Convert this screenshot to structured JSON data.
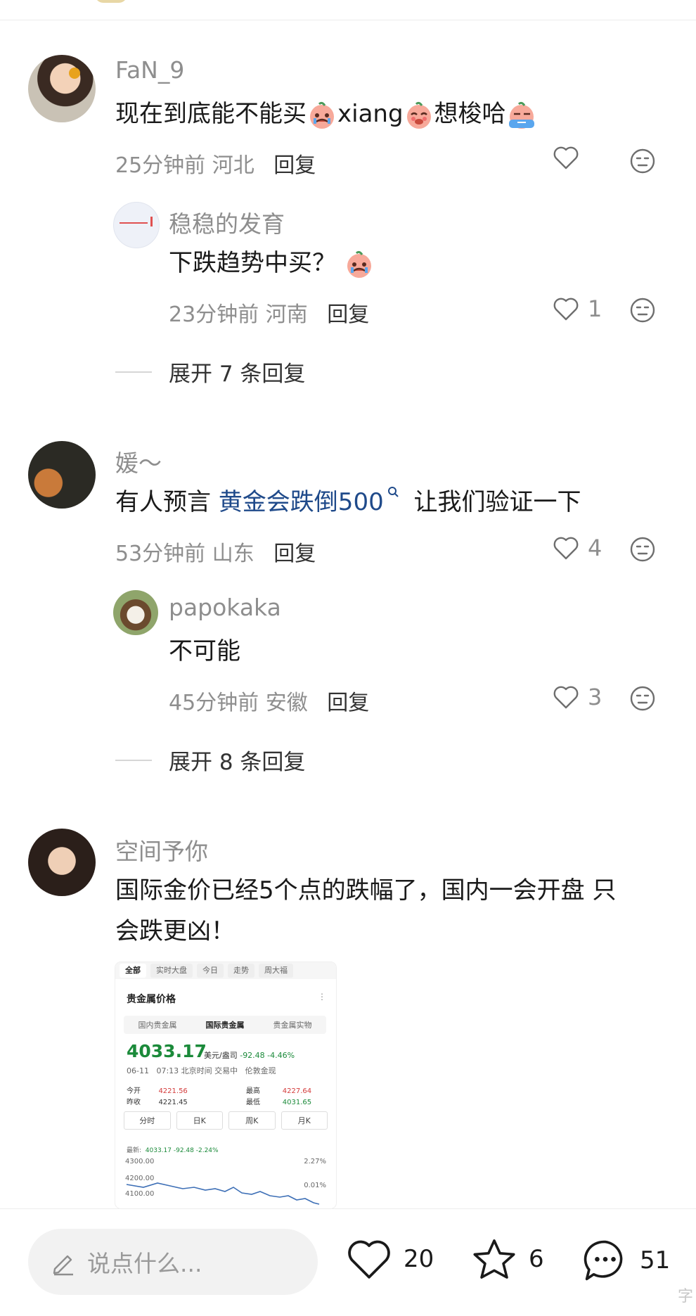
{
  "comments": [
    {
      "username": "FaN_9",
      "text_parts": [
        "现在到底能不能买",
        "xiang",
        "想梭哈"
      ],
      "time": "25分钟前",
      "location": "河北",
      "reply_label": "回复",
      "likes": "",
      "replies": [
        {
          "username": "稳稳的发育",
          "text": "下跌趋势中买？",
          "time": "23分钟前",
          "location": "河南",
          "reply_label": "回复",
          "likes": "1"
        }
      ],
      "expand_label": "展开 7 条回复"
    },
    {
      "username": "媛～",
      "text_prefix": "有人预言 ",
      "link_text": "黄金会跌倒500",
      "text_suffix": "让我们验证一下",
      "time": "53分钟前",
      "location": "山东",
      "reply_label": "回复",
      "likes": "4",
      "replies": [
        {
          "username": "papokaka",
          "text": "不可能",
          "time": "45分钟前",
          "location": "安徽",
          "reply_label": "回复",
          "likes": "3"
        }
      ],
      "expand_label": "展开 8 条回复"
    },
    {
      "username": "空间予你",
      "text_line1": "国际金价已经5个点的跌幅了，国内一会开盘 只",
      "text_line2": "会跌更凶！",
      "image": {
        "tabs": [
          "全部",
          "实时大盘",
          "今日",
          "走势",
          "周大福"
        ],
        "title": "贵金属价格",
        "more": "⋮",
        "subtabs": [
          "国内贵金属",
          "国际贵金属",
          "贵金属实物"
        ],
        "price": "4033.17",
        "unit": "美元/盎司",
        "change": "-92.48 -4.46%",
        "date": "06-11",
        "time_info": "07:13 北京时间 交易中",
        "market": "伦敦金现",
        "open_label": "今开",
        "open_value": "4221.56",
        "prev_label": "昨收",
        "prev_value": "4221.45",
        "high_label": "最高",
        "high_value": "4227.64",
        "low_label": "最低",
        "low_value": "4031.65",
        "periods": [
          "分时",
          "日K",
          "周K",
          "月K"
        ],
        "latest_label": "最新:",
        "latest_value": "4033.17 -92.48 -2.24%",
        "y_ticks": [
          "4300.00",
          "4200.00",
          "4100.00"
        ],
        "right_ticks": [
          "2.27%",
          "0.01%"
        ]
      }
    }
  ],
  "bottom_bar": {
    "input_placeholder": "说点什么...",
    "likes": "20",
    "favorites": "6",
    "comments": "51",
    "watermark": "字"
  },
  "colors": {
    "link": "#1f4a8a",
    "meta": "#8e8e8e",
    "price_green": "#1b8a3a",
    "price_red": "#d43b3b"
  }
}
